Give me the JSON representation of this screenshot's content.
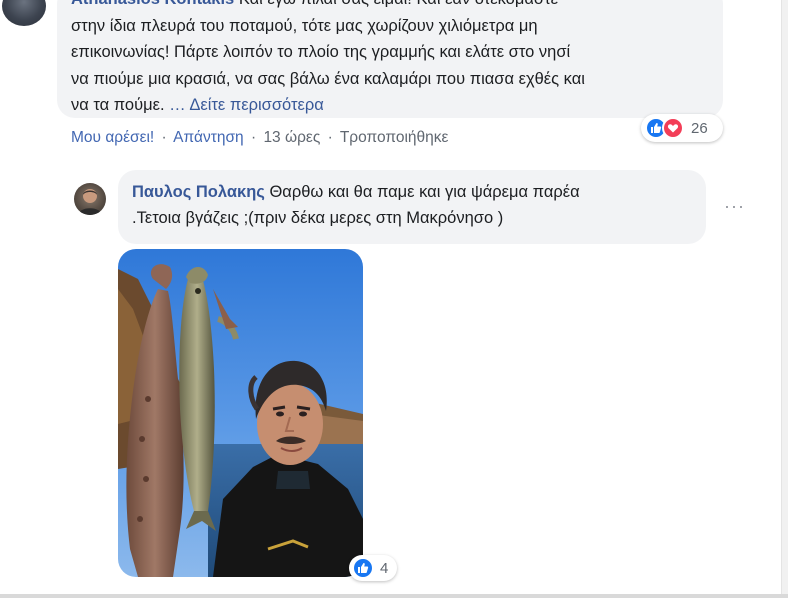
{
  "comment_1": {
    "author": "Athanasios Kontakis",
    "lines": [
      "Και εγώ πιλάι σας είμαι! Και εάν ότεκομαστε",
      "στην ίδια πλευρά του ποταμού, τότε μας χωρίζουν χιλιόμετρα μη",
      "επικοινωνίας! Πάρτε λοιπόν το πλοίο της γραμμής και ελάτε στο νησί",
      "να πιούμε μια κρασιά, να σας βάλω ένα καλαμάρι που πιασα εχθές και",
      "να τα πούμε. "
    ],
    "see_more": "… Δείτε περισσότερα",
    "actions": {
      "like": "Μου αρέσει!",
      "reply": "Απάντηση",
      "time": "13 ώρες",
      "edited": "Τροποποιήθηκε",
      "separator": "·"
    },
    "reactions": {
      "count": "26",
      "icons": [
        "like-icon",
        "love-icon"
      ]
    }
  },
  "comment_2": {
    "author": "Παυλος Πολακης",
    "text_line_1": " Θαρθω και θα παμε και για ψάρεμα παρέα",
    "text_line_2": ".Τετοια βγάζεις ;(πριν δέκα μερες στη Μακρόνησο )",
    "more_options": "···",
    "photo": {
      "icon": "selfie-with-fish-photo"
    },
    "reactions": {
      "count": "4",
      "icons": [
        "like-icon"
      ]
    }
  },
  "colors": {
    "link": "#385898",
    "bubble": "#f2f3f5",
    "meta": "#606770",
    "like_blue": "#1877f2",
    "love_red": "#f33e58"
  }
}
